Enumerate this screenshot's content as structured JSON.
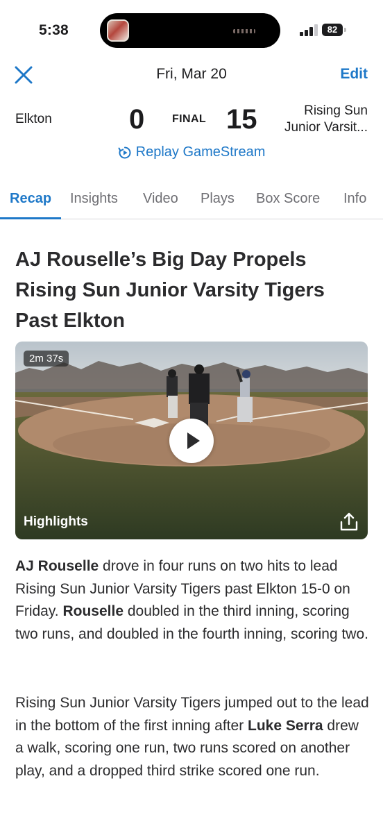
{
  "status_bar": {
    "time": "5:38",
    "battery": "82"
  },
  "header": {
    "date": "Fri, Mar 20",
    "edit_label": "Edit"
  },
  "score": {
    "home_team": "Elkton",
    "home_score": "0",
    "status": "FINAL",
    "away_score": "15",
    "away_team_line1": "Rising Sun",
    "away_team_line2": "Junior Varsit..."
  },
  "replay_label": "Replay GameStream",
  "tabs": [
    {
      "label": "Recap",
      "active": true
    },
    {
      "label": "Insights",
      "active": false
    },
    {
      "label": "Video",
      "active": false
    },
    {
      "label": "Plays",
      "active": false
    },
    {
      "label": "Box Score",
      "active": false
    },
    {
      "label": "Info",
      "active": false
    }
  ],
  "article": {
    "headline": "AJ Rouselle’s Big Day Propels Rising Sun Junior Varsity Tigers Past Elkton",
    "video": {
      "duration": "2m 37s",
      "label": "Highlights"
    },
    "p1": {
      "s1": "AJ Rouselle",
      "s2": " drove in four runs on two hits to lead Rising Sun Junior Varsity Tigers past Elkton 15-0 on Friday. ",
      "s3": "Rouselle",
      "s4": " doubled in the third inning, scoring two runs, and doubled in the fourth inning, scoring two."
    },
    "p2": {
      "s1": "Rising Sun Junior Varsity Tigers jumped out to the lead in the bottom of the first inning after ",
      "s2": "Luke Serra",
      "s3": " drew a walk, scoring one run, two runs scored on another play, and a dropped third strike scored one run."
    }
  },
  "colors": {
    "accent": "#1e78c8",
    "text": "#2b2b2d",
    "muted": "#6e6e73"
  },
  "icons": [
    "close-icon",
    "replay-icon",
    "play-icon",
    "share-icon",
    "signal-icon",
    "battery-icon"
  ]
}
